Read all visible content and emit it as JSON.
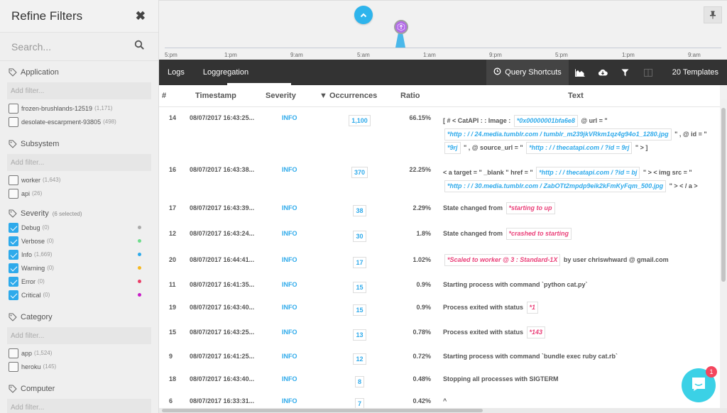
{
  "sidebar": {
    "title": "Refine Filters",
    "search_placeholder": "Search...",
    "sections": {
      "application": {
        "label": "Application",
        "add_filter_placeholder": "Add filter...",
        "options": [
          {
            "label": "frozen-brushlands-12519",
            "count": "(1,171)",
            "checked": false
          },
          {
            "label": "desolate-escarpment-93805",
            "count": "(498)",
            "checked": false
          }
        ]
      },
      "subsystem": {
        "label": "Subsystem",
        "add_filter_placeholder": "Add filter...",
        "options": [
          {
            "label": "worker",
            "count": "(1,643)",
            "checked": false
          },
          {
            "label": "api",
            "count": "(26)",
            "checked": false
          }
        ]
      },
      "severity": {
        "label": "Severity",
        "sub_label": "(6 selected)",
        "options": [
          {
            "label": "Debug",
            "count": "(0)",
            "checked": true,
            "color": "#aaaaaa"
          },
          {
            "label": "Verbose",
            "count": "(0)",
            "checked": true,
            "color": "#6fdc8c"
          },
          {
            "label": "Info",
            "count": "(1,669)",
            "checked": true,
            "color": "#2eaaeb"
          },
          {
            "label": "Warning",
            "count": "(0)",
            "checked": true,
            "color": "#f5b821"
          },
          {
            "label": "Error",
            "count": "(0)",
            "checked": true,
            "color": "#ea3f68"
          },
          {
            "label": "Critical",
            "count": "(0)",
            "checked": true,
            "color": "#c71cc7"
          }
        ]
      },
      "category": {
        "label": "Category",
        "add_filter_placeholder": "Add filter...",
        "options": [
          {
            "label": "app",
            "count": "(1,524)",
            "checked": false
          },
          {
            "label": "heroku",
            "count": "(145)",
            "checked": false
          }
        ]
      },
      "computer": {
        "label": "Computer",
        "add_filter_placeholder": "Add filter..."
      }
    }
  },
  "timeline": {
    "ticks": [
      "5:pm",
      "1:pm",
      "9:am",
      "5:am",
      "1:am",
      "9:pm",
      "5:pm",
      "1:pm",
      "9:am"
    ]
  },
  "toolbar": {
    "tabs": [
      "Logs",
      "Loggregation"
    ],
    "active_tab": "Loggregation",
    "query_shortcuts": "Query Shortcuts",
    "templates": "20 Templates"
  },
  "table": {
    "headers": {
      "num": "#",
      "timestamp": "Timestamp",
      "severity": "Severity",
      "occurrences": "▼ Occurrences",
      "ratio": "Ratio",
      "text": "Text"
    },
    "rows": [
      {
        "num": "14",
        "timestamp": "08/07/2017 16:43:25...",
        "severity": "INFO",
        "occurrences": "1,100",
        "ratio": "66.15%",
        "text": [
          {
            "t": "[ # < CatAPI : : Image : "
          },
          {
            "tok": "*0x00000001bfa6e8",
            "c": "blue"
          },
          {
            "t": " @ url = \" "
          },
          {
            "tok": "*http : / / 24.media.tumblr.com / tumblr_m239jkVRkm1qz4g94o1_1280.jpg",
            "c": "blue"
          },
          {
            "t": " \" , @ id = \" "
          },
          {
            "tok": "*9rj",
            "c": "blue"
          },
          {
            "t": " \" , @ source_url = \" "
          },
          {
            "tok": "*http : / / thecatapi.com / ?id = 9rj",
            "c": "blue"
          },
          {
            "t": " \" > ]"
          }
        ]
      },
      {
        "num": "16",
        "timestamp": "08/07/2017 16:43:38...",
        "severity": "INFO",
        "occurrences": "370",
        "ratio": "22.25%",
        "text": [
          {
            "t": "< a target = \" _blank \" href = \" "
          },
          {
            "tok": "*http : / / thecatapi.com / ?id = bj",
            "c": "blue"
          },
          {
            "t": " \" > < img src = \" "
          },
          {
            "tok": "*http : / / 30.media.tumblr.com / ZabOTt2mpdp9eik2kFmKyFqm_500.jpg",
            "c": "blue"
          },
          {
            "t": " \" > < / a >"
          }
        ]
      },
      {
        "num": "17",
        "timestamp": "08/07/2017 16:43:39...",
        "severity": "INFO",
        "occurrences": "38",
        "ratio": "2.29%",
        "text": [
          {
            "t": "State changed from "
          },
          {
            "tok": "*starting to up",
            "c": "pink"
          }
        ]
      },
      {
        "num": "12",
        "timestamp": "08/07/2017 16:43:24...",
        "severity": "INFO",
        "occurrences": "30",
        "ratio": "1.8%",
        "text": [
          {
            "t": "State changed from "
          },
          {
            "tok": "*crashed to starting",
            "c": "pink"
          }
        ]
      },
      {
        "num": "20",
        "timestamp": "08/07/2017 16:44:41...",
        "severity": "INFO",
        "occurrences": "17",
        "ratio": "1.02%",
        "text": [
          {
            "tok": "*Scaled to worker @ 3 : Standard-1X",
            "c": "pink"
          },
          {
            "t": " by user chriswhward @ gmail.com"
          }
        ]
      },
      {
        "num": "11",
        "timestamp": "08/07/2017 16:41:35...",
        "severity": "INFO",
        "occurrences": "15",
        "ratio": "0.9%",
        "text": [
          {
            "t": "Starting process with command `python cat.py`"
          }
        ]
      },
      {
        "num": "19",
        "timestamp": "08/07/2017 16:43:40...",
        "severity": "INFO",
        "occurrences": "15",
        "ratio": "0.9%",
        "text": [
          {
            "t": "Process exited with status "
          },
          {
            "tok": "*1",
            "c": "pink"
          }
        ]
      },
      {
        "num": "15",
        "timestamp": "08/07/2017 16:43:25...",
        "severity": "INFO",
        "occurrences": "13",
        "ratio": "0.78%",
        "text": [
          {
            "t": "Process exited with status "
          },
          {
            "tok": "*143",
            "c": "pink"
          }
        ]
      },
      {
        "num": "9",
        "timestamp": "08/07/2017 16:41:25...",
        "severity": "INFO",
        "occurrences": "12",
        "ratio": "0.72%",
        "text": [
          {
            "t": "Starting process with command `bundle exec ruby cat.rb`"
          }
        ]
      },
      {
        "num": "18",
        "timestamp": "08/07/2017 16:43:40...",
        "severity": "INFO",
        "occurrences": "8",
        "ratio": "0.48%",
        "text": [
          {
            "t": "Stopping all processes with SIGTERM"
          }
        ]
      },
      {
        "num": "6",
        "timestamp": "08/07/2017 16:33:31...",
        "severity": "INFO",
        "occurrences": "7",
        "ratio": "0.42%",
        "text": [
          {
            "t": "^"
          }
        ]
      }
    ]
  },
  "chat": {
    "badge": "1"
  },
  "icons": {
    "close": "close-icon",
    "search": "search-icon",
    "tag": "tag-icon",
    "chevron_up": "chevron-up-icon",
    "deploy_marker": "deploy-marker-icon",
    "pin": "pin-icon",
    "clock": "clock-icon",
    "area_chart": "area-chart-icon",
    "download": "cloud-download-icon",
    "filter": "filter-icon",
    "columns": "columns-icon",
    "chat": "chat-icon"
  }
}
